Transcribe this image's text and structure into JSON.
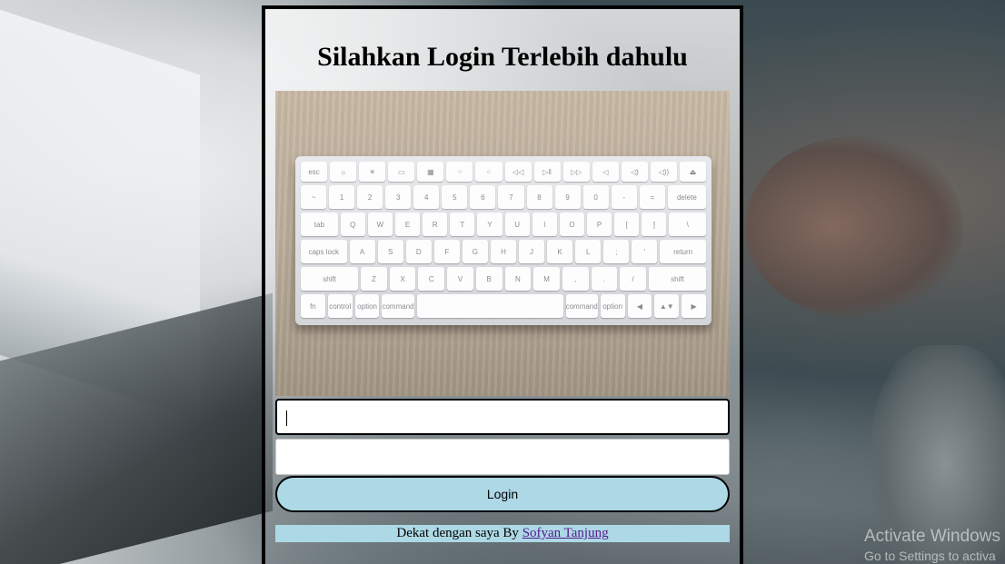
{
  "page": {
    "title": "Silahkan Login Terlebih dahulu"
  },
  "hero_image": {
    "icon": "keyboard-photo"
  },
  "form": {
    "username_value": "",
    "password_value": "",
    "login_label": "Login"
  },
  "footer": {
    "text": "Dekat dengan saya By ",
    "link_text": "Sofyan Tanjung"
  },
  "watermark": {
    "line1": "Activate Windows",
    "line2": "Go to Settings to activa"
  },
  "colors": {
    "button_bg": "#add8e6",
    "footer_bg": "#add8e6",
    "border": "#000000",
    "link": "#551a8b"
  },
  "keyboard_rows": [
    [
      "esc",
      "☼",
      "☀",
      "▭",
      "▦",
      "⁘",
      "⁘",
      "◁◁",
      "▷‖",
      "▷▷",
      "◁",
      "◁)",
      "◁))",
      "⏏"
    ],
    [
      "~",
      "1",
      "2",
      "3",
      "4",
      "5",
      "6",
      "7",
      "8",
      "9",
      "0",
      "-",
      "=",
      "delete"
    ],
    [
      "tab",
      "Q",
      "W",
      "E",
      "R",
      "T",
      "Y",
      "U",
      "I",
      "O",
      "P",
      "[",
      "]",
      "\\"
    ],
    [
      "caps lock",
      "A",
      "S",
      "D",
      "F",
      "G",
      "H",
      "J",
      "K",
      "L",
      ";",
      "'",
      "return"
    ],
    [
      "shift",
      "Z",
      "X",
      "C",
      "V",
      "B",
      "N",
      "M",
      ",",
      ".",
      "/",
      "shift"
    ],
    [
      "fn",
      "control",
      "option",
      "command",
      "",
      "command",
      "option",
      "◀",
      "▲▼",
      "▶"
    ]
  ]
}
